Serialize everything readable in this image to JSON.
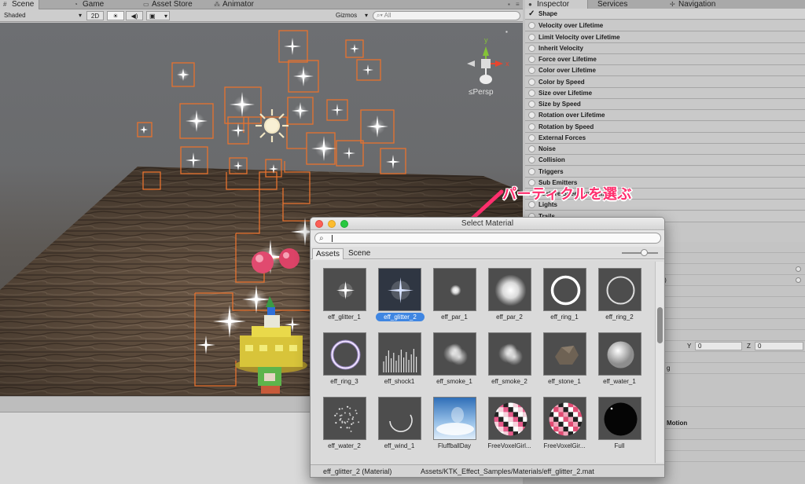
{
  "scene_tabs": [
    {
      "label": "Scene",
      "icon": "grid-icon"
    },
    {
      "label": "Game",
      "icon": "pacman-icon"
    },
    {
      "label": "Asset Store",
      "icon": "store-icon"
    },
    {
      "label": "Animator",
      "icon": "animator-icon"
    }
  ],
  "inspector_tabs": [
    {
      "label": "Inspector",
      "icon": "info-icon"
    },
    {
      "label": "Services",
      "icon": ""
    },
    {
      "label": "Navigation",
      "icon": "navigation-icon"
    }
  ],
  "toolbar": {
    "shading": "Shaded",
    "mode_2d": "2D",
    "gizmos": "Gizmos",
    "search_placeholder": "All"
  },
  "scene": {
    "persp_label": "Persp",
    "axis_y": "y",
    "axis_x": "x"
  },
  "inspector": {
    "modules": [
      "Shape",
      "Velocity over Lifetime",
      "Limit Velocity over Lifetime",
      "Inherit Velocity",
      "Force over Lifetime",
      "Color over Lifetime",
      "Color by Speed",
      "Size over Lifetime",
      "Size by Speed",
      "Rotation over Lifetime",
      "Rotation by Speed",
      "External Forces",
      "Noise",
      "Collision",
      "Triggers",
      "Sub Emitters",
      "Texture Sheet Animation",
      "Lights",
      "Trails"
    ],
    "checked_module": "Shape",
    "renderer_material": "er_2",
    "renderer_material_type": "erial)",
    "y_label": "Y",
    "y_value": "0",
    "z_label": "Z",
    "z_value": "0",
    "partial_g": "g",
    "motion_label": "Motion"
  },
  "annotation": {
    "text": "パーティクルを選ぶ",
    "color": "#ff2f6e"
  },
  "select_material": {
    "title": "Select Material",
    "tabs": [
      "Assets",
      "Scene"
    ],
    "active_tab": "Assets",
    "search_value": "",
    "items": [
      {
        "name": "eff_glitter_1",
        "icon": "glitter-icon",
        "selected": false
      },
      {
        "name": "eff_glitter_2",
        "icon": "glitter-icon",
        "selected": true
      },
      {
        "name": "eff_par_1",
        "icon": "particle-icon",
        "selected": false
      },
      {
        "name": "eff_par_2",
        "icon": "particle-icon",
        "selected": false
      },
      {
        "name": "eff_ring_1",
        "icon": "ring-icon",
        "selected": false
      },
      {
        "name": "eff_ring_2",
        "icon": "ring-icon",
        "selected": false
      },
      {
        "name": "eff_ring_3",
        "icon": "ring-icon",
        "selected": false
      },
      {
        "name": "eff_shock1",
        "icon": "shock-icon",
        "selected": false
      },
      {
        "name": "eff_smoke_1",
        "icon": "smoke-icon",
        "selected": false
      },
      {
        "name": "eff_smoke_2",
        "icon": "smoke-icon",
        "selected": false
      },
      {
        "name": "eff_stone_1",
        "icon": "stone-icon",
        "selected": false
      },
      {
        "name": "eff_water_1",
        "icon": "water-icon",
        "selected": false
      },
      {
        "name": "eff_water_2",
        "icon": "water-icon",
        "selected": false
      },
      {
        "name": "eff_wind_1",
        "icon": "wind-icon",
        "selected": false
      },
      {
        "name": "FluffballDay",
        "icon": "sky-icon",
        "selected": false
      },
      {
        "name": "FreeVoxelGirl...",
        "icon": "voxel-sphere-icon",
        "selected": false
      },
      {
        "name": "FreeVoxelGir...",
        "icon": "voxel-sphere-icon",
        "selected": false
      },
      {
        "name": "Full",
        "icon": "black-sphere-icon",
        "selected": false
      }
    ],
    "status_name": "eff_glitter_2 (Material)",
    "status_path": "Assets/KTK_Effect_Samples/Materials/eff_glitter_2.mat"
  }
}
